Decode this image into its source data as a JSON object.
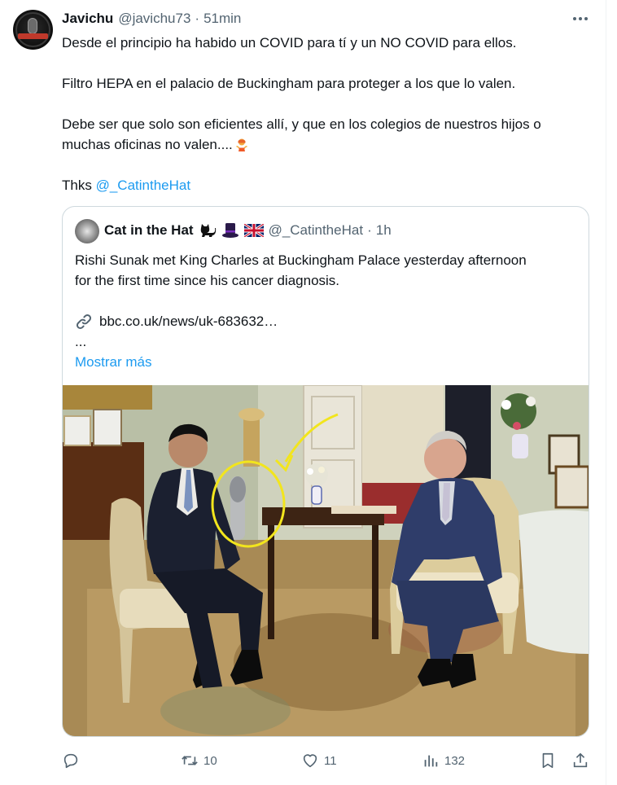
{
  "tweet": {
    "author_name": "Javichu",
    "author_handle": "@javichu73",
    "separator": "·",
    "time": "51min",
    "lines": [
      "Desde el principio ha habido un COVID para tí y un NO COVID para ellos.",
      "Filtro HEPA en el palacio de Buckingham para proteger a los que lo valen.",
      "Debe ser que solo son eficientes allí, y que en los colegios de nuestros hijos o",
      "muchas oficinas no valen...."
    ],
    "thanks_prefix": "Thks",
    "thanks_mention": "@_CatintheHat",
    "emoji": "woman-shrugging-emoji"
  },
  "quote": {
    "author_name": "Cat in the Hat",
    "author_handle": "@_CatintheHat",
    "separator": "·",
    "time": "1h",
    "name_icons": [
      "black-cat-icon",
      "top-hat-icon",
      "uk-flag-icon"
    ],
    "lines": [
      "Rishi Sunak met King Charles at Buckingham Palace yesterday afternoon",
      "for the first time since his cancer diagnosis."
    ],
    "link_text": "bbc.co.uk/news/uk-683632…",
    "ellipsis": "...",
    "show_more": "Mostrar más"
  },
  "actions": {
    "reply_count": "",
    "retweet_count": "10",
    "like_count": "11",
    "views_count": "132"
  },
  "colors": {
    "accent": "#1d9bf0",
    "secondary_text": "#536471",
    "border": "#cfd9de",
    "annotation": "#f2e51d"
  }
}
